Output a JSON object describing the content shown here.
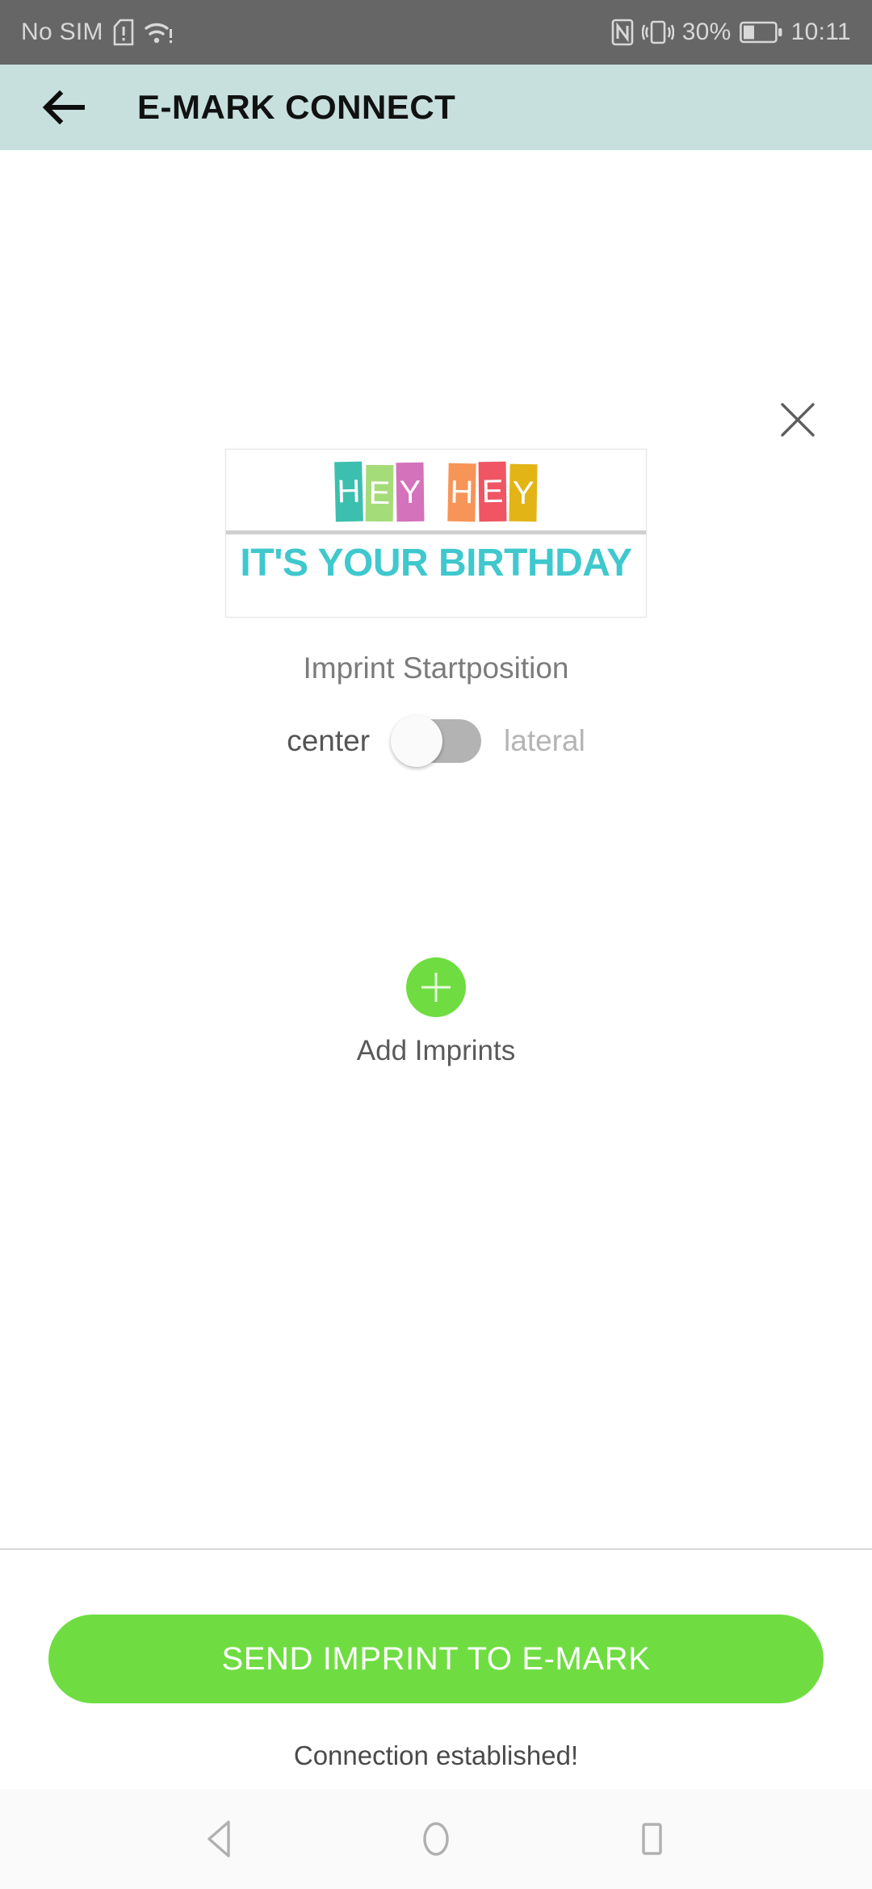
{
  "status_bar": {
    "carrier": "No SIM",
    "sim_icon": "sim-card-alert-icon",
    "wifi_icon": "wifi-warning-icon",
    "nfc_icon": "nfc-icon",
    "vibrate_icon": "vibrate-icon",
    "battery_percent": "30%",
    "battery_icon": "battery-30-icon",
    "time": "10:11",
    "background_color": "#666666",
    "text_color": "#d8d8d8"
  },
  "app_bar": {
    "back_icon": "arrow-left-icon",
    "title": "E-MARK CONNECT",
    "background_color": "#c7e0dd"
  },
  "imprint": {
    "close_icon": "close-icon",
    "preview": {
      "hey_blocks": [
        {
          "letter": "H",
          "color": "#3cbfae"
        },
        {
          "letter": "E",
          "color": "#a5dc7a"
        },
        {
          "letter": "Y",
          "color": "#d472bc"
        },
        {
          "letter": "H",
          "color": "#f79457"
        },
        {
          "letter": "E",
          "color": "#ef5563"
        },
        {
          "letter": "Y",
          "color": "#e3b416"
        }
      ],
      "headline": "IT'S YOUR BIRTHDAY",
      "headline_color": "#3fc8cd"
    },
    "startposition_label": "Imprint Startposition",
    "toggle": {
      "left_option": "center",
      "right_option": "lateral",
      "selected": "center",
      "track_color": "#b3b3b3",
      "knob_color": "#fafafa"
    }
  },
  "add_imprints": {
    "plus_icon": "plus-icon",
    "label": "Add Imprints",
    "accent_color": "#6fdd41"
  },
  "footer": {
    "send_button_label": "SEND IMPRINT TO E-MARK",
    "send_button_color": "#6fdd41",
    "connection_status": "Connection established!"
  },
  "nav_bar": {
    "back_icon": "triangle-back-icon",
    "home_icon": "circle-home-icon",
    "recents_icon": "square-recents-icon",
    "background_color": "#fafafa"
  }
}
